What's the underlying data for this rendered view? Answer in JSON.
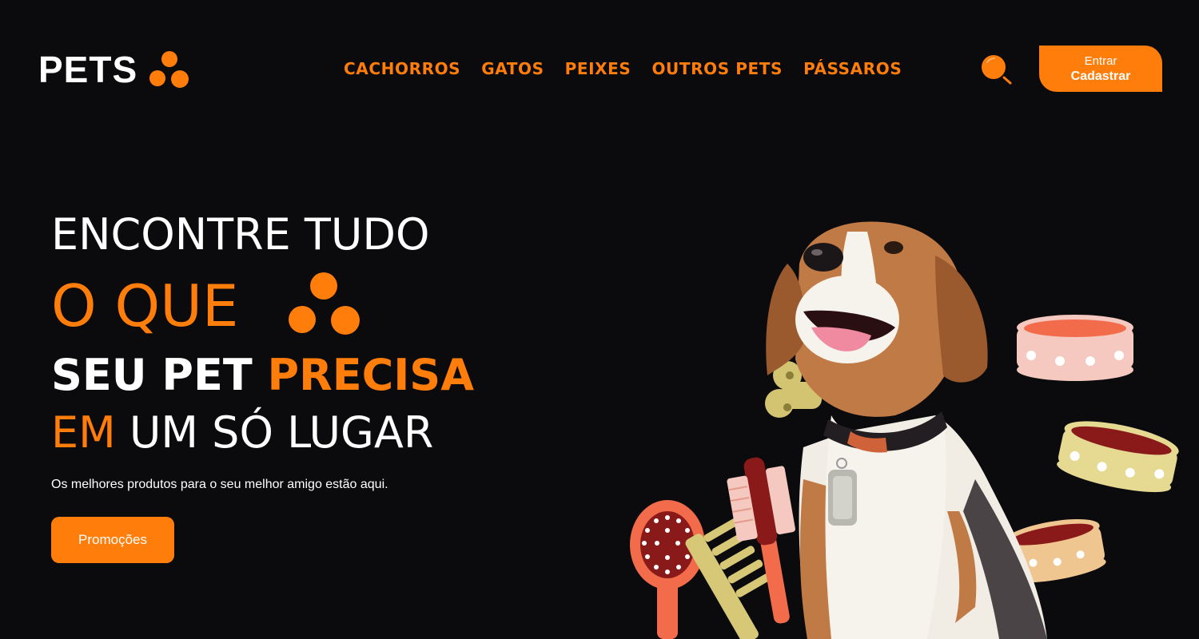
{
  "header": {
    "logo_text": "PETS",
    "nav": [
      "CACHORROS",
      "GATOS",
      "PEIXES",
      "OUTROS PETS",
      "PÁSSAROS"
    ],
    "search_icon": "search-icon",
    "auth": {
      "login_label": "Entrar",
      "register_label": "Cadastrar"
    }
  },
  "hero": {
    "line1": "ENCONTRE TUDO",
    "line2": "O QUE",
    "line3_white": "SEU PET ",
    "line3_orange": "PRECISA",
    "line4_orange": "EM",
    "line4_white": " UM SÓ LUGAR",
    "subtitle": "Os melhores produtos para o seu melhor amigo estão aqui.",
    "promo_button": "Promoções",
    "image": "beagle-with-pet-accessories"
  },
  "colors": {
    "accent": "#ff7d0a",
    "background": "#0b0a0c",
    "text": "#ffffff"
  }
}
